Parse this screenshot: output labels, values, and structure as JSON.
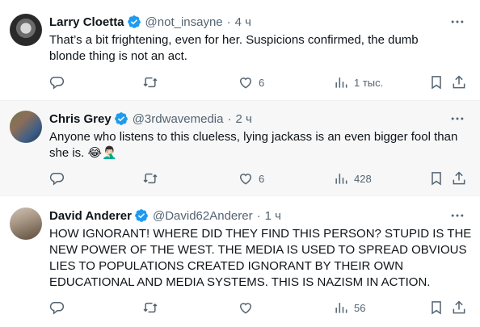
{
  "tweets": [
    {
      "name": "Larry Cloetta",
      "handle": "@not_insayne",
      "time": "4 ч",
      "text_lines": [
        "That’s a bit frightening, even for her. Suspicions confirmed, the dumb",
        "blonde thing is not an act."
      ],
      "likes": "6",
      "views": "1 тыс."
    },
    {
      "name": "Chris Grey",
      "handle": "@3rdwavemedia",
      "time": "2 ч",
      "text_lines": [
        "Anyone who listens to this clueless, lying jackass is an even bigger fool than",
        "she is. 😂🤦🏻‍♂️"
      ],
      "likes": "6",
      "views": "428"
    },
    {
      "name": "David Anderer",
      "handle": "@David62Anderer",
      "time": "1 ч",
      "text_lines": [
        "HOW IGNORANT! WHERE DID THEY FIND THIS PERSON? STUPID IS THE",
        "NEW POWER OF THE WEST. THE MEDIA IS USED TO SPREAD OBVIOUS",
        "LIES TO POPULATIONS CREATED IGNORANT BY THEIR OWN",
        "EDUCATIONAL AND MEDIA SYSTEMS. THIS IS NAZISM IN ACTION."
      ],
      "likes": "",
      "views": "56"
    }
  ],
  "separator": "·",
  "colors": {
    "verified": "#1d9bf0",
    "secondary": "#536471",
    "hover_bg": "#f7f7f7"
  },
  "icons": [
    "verified-badge-icon",
    "more-icon",
    "reply-icon",
    "retweet-icon",
    "like-icon",
    "views-icon",
    "bookmark-icon",
    "share-icon"
  ]
}
